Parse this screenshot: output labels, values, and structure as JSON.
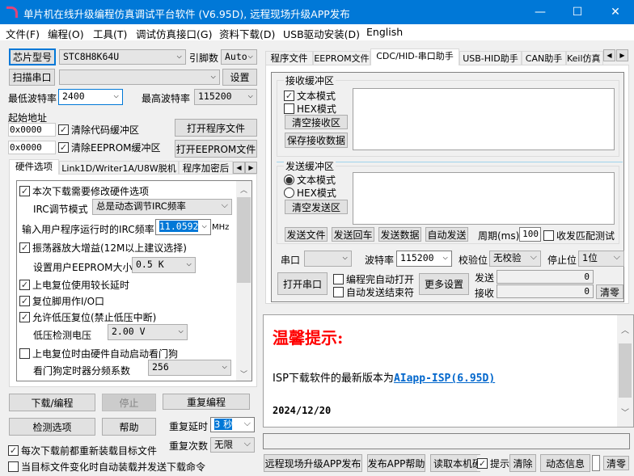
{
  "window": {
    "title": "单片机在线升级编程仿真调试平台软件 (V6.95D), 远程现场升级APP发布",
    "minimize": "—",
    "maximize": "☐",
    "close": "✕"
  },
  "menu": [
    "文件(F)",
    "编程(O)",
    "工具(T)",
    "调试仿真接口(G)",
    "资料下载(D)",
    "USB驱动安装(D)",
    "English"
  ],
  "left": {
    "chip_button": "芯片型号",
    "chip_value": "STC8H8K64U",
    "pins_label": "引脚数",
    "pins_value": "Auto",
    "scan_button": "扫描串口",
    "port_value": "",
    "settings_button": "设置",
    "min_baud_label": "最低波特率",
    "min_baud": "2400",
    "max_baud_label": "最高波特率",
    "max_baud": "115200",
    "start_addr_label": "起始地址",
    "addr1": "0x0000",
    "clear_code": "清除代码缓冲区",
    "open_program": "打开程序文件",
    "addr2": "0x0000",
    "clear_eeprom": "清除EEPROM缓冲区",
    "open_eeprom": "打开EEPROM文件",
    "tabs": [
      "硬件选项",
      "Link1D/Writer1A/U8W脱机",
      "程序加密后"
    ],
    "options": {
      "modify_hw": "本次下载需要修改硬件选项",
      "irc_mode_label": "IRC调节模式",
      "irc_mode": "总是动态调节IRC频率",
      "irc_freq_label": "输入用户程序运行时的IRC频率",
      "irc_freq": "11.0592",
      "mhz": "MHz",
      "osc_gain": "振荡器放大增益(12M以上建议选择)",
      "eeprom_size_label": "设置用户EEPROM大小",
      "eeprom_size": "0.5 K",
      "long_delay": "上电复位使用较长延时",
      "reset_io": "复位脚用作I/O口",
      "lvr": "允许低压复位(禁止低压中断)",
      "lv_label": "低压检测电压",
      "lv_value": "2.00 V",
      "wdt": "上电复位时由硬件自动启动看门狗",
      "wdt_div_label": "看门狗定时器分频系数",
      "wdt_div": "256"
    },
    "download": "下载/编程",
    "stop": "停止",
    "repeat": "重复编程",
    "check_opts": "检测选项",
    "help": "帮助",
    "repeat_delay_label": "重复延时",
    "repeat_delay": "3 秒",
    "repeat_count_label": "重复次数",
    "repeat_count": "无限",
    "reload_each": "每次下载前都重新装载目标文件",
    "auto_reload": "当目标文件变化时自动装载并发送下载命令"
  },
  "right": {
    "tabs": [
      "程序文件",
      "EEPROM文件",
      "CDC/HID-串口助手",
      "USB-HID助手",
      "CAN助手",
      "Keil仿真"
    ],
    "recv_group": "接收缓冲区",
    "recv_text": "文本模式",
    "recv_hex": "HEX模式",
    "clear_recv": "清空接收区",
    "save_recv": "保存接收数据",
    "send_group": "发送缓冲区",
    "send_text": "文本模式",
    "send_hex": "HEX模式",
    "clear_send": "清空发送区",
    "send_file": "发送文件",
    "send_cr": "发送回车",
    "send_data": "发送数据",
    "auto_send": "自动发送",
    "period_label": "周期(ms)",
    "period": "100",
    "match_test": "收发匹配测试",
    "port_label": "串口",
    "port": "",
    "baud_label": "波特率",
    "baud": "115200",
    "parity_label": "校验位",
    "parity": "无校验",
    "stop_label": "停止位",
    "stop": "1位",
    "open_port": "打开串口",
    "auto_open": "编程完自动打开",
    "auto_end": "自动发送结束符",
    "more": "更多设置",
    "sent_label": "发送",
    "sent": "0",
    "recv_label": "接收",
    "recv": "0",
    "zero": "清零"
  },
  "info": {
    "heading": "温馨提示:",
    "line_prefix": "ISP下载软件的最新版本为",
    "link": "AIapp-ISP(6.95D)",
    "date": "2024/12/20"
  },
  "bottom": {
    "publish": "远程现场升级APP发布",
    "publish_help": "发布APP帮助",
    "read_id": "读取本机硬",
    "hint": "提示",
    "clear": "清除",
    "dynamic": "动态信息",
    "zero": "清零"
  }
}
